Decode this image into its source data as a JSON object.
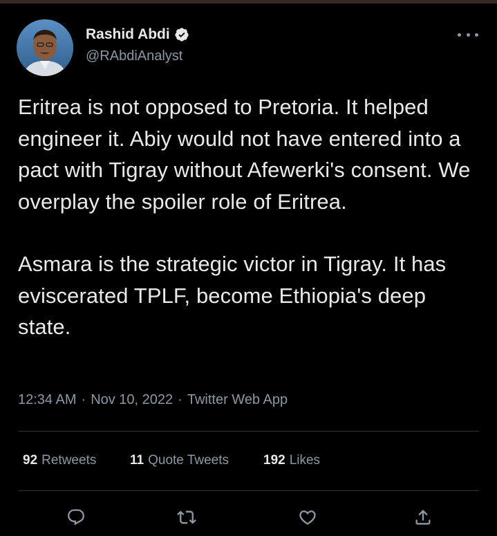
{
  "author": {
    "name": "Rashid Abdi",
    "handle": "@RAbdiAnalyst",
    "avatar_icon": "avatar-photo",
    "verified_icon": "verified-badge-icon"
  },
  "tweet": {
    "paragraphs": [
      "Eritrea is not opposed to Pretoria. It helped engineer it. Abiy would not have entered into a pact with Tigray without Afewerki's consent. We overplay the spoiler role of Eritrea.",
      "Asmara is the strategic victor in Tigray. It has eviscerated TPLF, become Ethiopia's deep state."
    ],
    "time": "12:34 AM",
    "date": "Nov 10, 2022",
    "source": "Twitter Web App",
    "separator": "·"
  },
  "stats": {
    "retweets_count": "92",
    "retweets_label": "Retweets",
    "quotes_count": "11",
    "quotes_label": "Quote Tweets",
    "likes_count": "192",
    "likes_label": "Likes"
  },
  "actions": {
    "reply_icon": "reply-icon",
    "retweet_icon": "retweet-icon",
    "like_icon": "like-icon",
    "share_icon": "share-icon"
  },
  "colors": {
    "background": "#000000",
    "text": "#e7e9ea",
    "secondary_text": "#8b98a5",
    "divider": "#2f3336",
    "verified_badge": "#e7e9ea"
  }
}
